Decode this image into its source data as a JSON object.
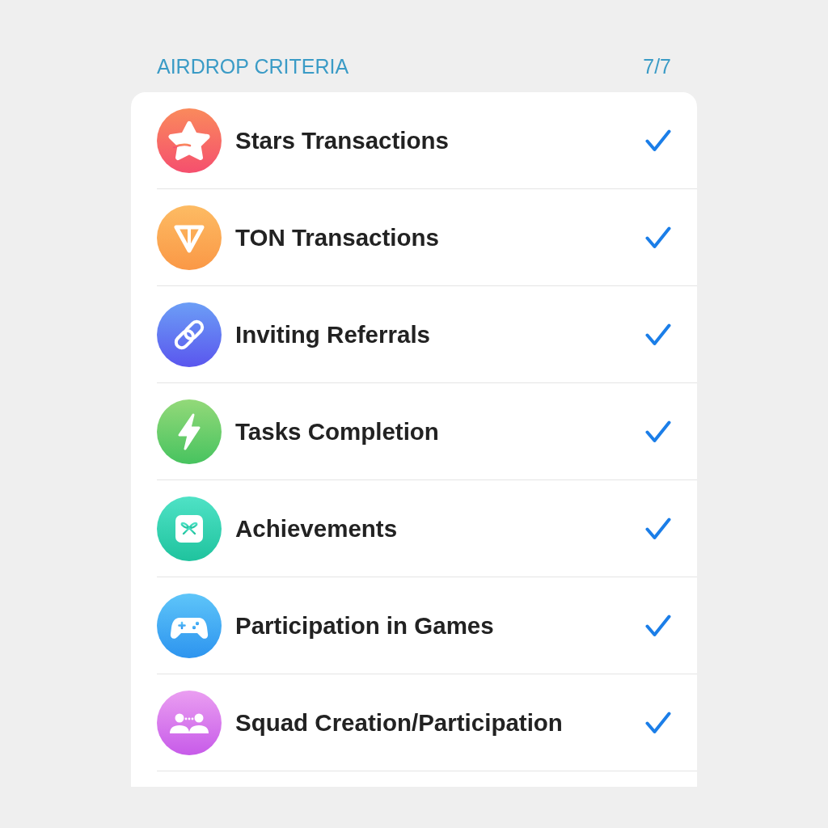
{
  "header": {
    "title": "AIRDROP CRITERIA",
    "count": "7/7"
  },
  "criteria": [
    {
      "kind": "star",
      "label": "Stars Transactions",
      "checked": true
    },
    {
      "kind": "ton",
      "label": "TON Transactions",
      "checked": true
    },
    {
      "kind": "link",
      "label": "Inviting Referrals",
      "checked": true
    },
    {
      "kind": "bolt",
      "label": "Tasks Completion",
      "checked": true
    },
    {
      "kind": "gift",
      "label": "Achievements",
      "checked": true
    },
    {
      "kind": "gamepad",
      "label": "Participation in Games",
      "checked": true
    },
    {
      "kind": "people",
      "label": "Squad Creation/Participation",
      "checked": true
    }
  ]
}
